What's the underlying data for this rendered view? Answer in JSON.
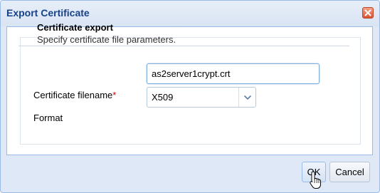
{
  "window": {
    "title": "Export Certificate"
  },
  "section": {
    "title": "Certificate export",
    "description": "Specify certificate file parameters."
  },
  "form": {
    "filename_label": "Certificate filename",
    "required_marker": "*",
    "filename_value": "as2server1crypt.crt",
    "format_label": "Format",
    "format_value": "X509"
  },
  "buttons": {
    "ok": "OK",
    "cancel": "Cancel"
  },
  "icons": {
    "close": "close-icon",
    "dropdown": "chevron-down-icon",
    "cursor": "hand-pointer-icon"
  },
  "colors": {
    "title_text": "#15428b",
    "close_button": "#d9542f",
    "required_marker": "#cc0000",
    "frame_border": "#99bbe8"
  }
}
